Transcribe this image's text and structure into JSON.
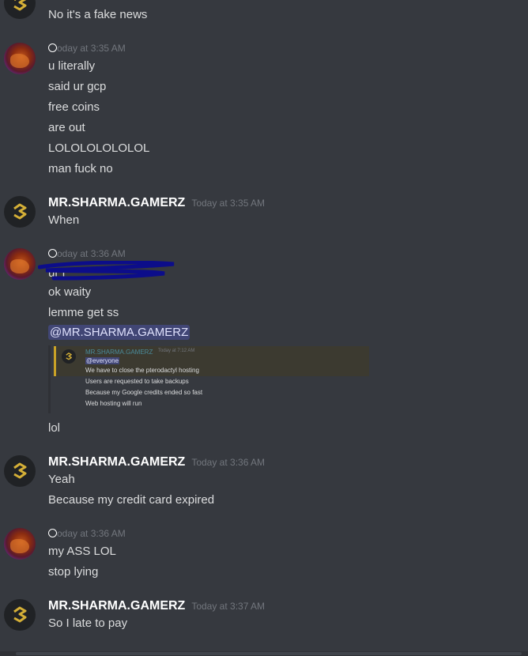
{
  "messages": {
    "m0": {
      "text": "No it's a fake news"
    },
    "g1": {
      "timestamp": "oday at 3:35 AM",
      "lines": [
        "u literally",
        "said ur gcp",
        "free coins",
        "are out",
        "LOLOLOLOLOLOL",
        "man fuck no"
      ]
    },
    "g2": {
      "username": "MR.SHARMA.GAMERZ",
      "timestamp": "Today at 3:35 AM",
      "lines": [
        "When"
      ]
    },
    "g3": {
      "timestamp": "oday at 3:36 AM",
      "redacted_fragment": "ur f",
      "lines": [
        "ok waity",
        "lemme get ss"
      ],
      "mention": "@MR.SHARMA.GAMERZ",
      "after_embed": "lol"
    },
    "g4": {
      "username": "MR.SHARMA.GAMERZ",
      "timestamp": "Today at 3:36 AM",
      "lines": [
        "Yeah",
        "Because my credit card expired"
      ]
    },
    "g5": {
      "timestamp": "oday at 3:36 AM",
      "lines": [
        "my ASS LOL",
        "stop lying"
      ]
    },
    "g6": {
      "username": "MR.SHARMA.GAMERZ",
      "timestamp": "Today at 3:37 AM",
      "lines": [
        "So I late to pay"
      ]
    }
  },
  "embed": {
    "username": "MR.SHARMA.GAMERZ",
    "timestamp": "Today at 7:12 AM",
    "mention": "@everyone",
    "lines": [
      "We have to close the pterodactyl hosting",
      "Users are requested to take backups",
      "Because my Google credits ended so fast",
      "Web hosting will run"
    ]
  },
  "colors": {
    "background": "#36393f",
    "username": "#ffffff",
    "timestamp": "#72767d",
    "mention_bg": "#414675",
    "logo_gold": "#d4af37"
  }
}
